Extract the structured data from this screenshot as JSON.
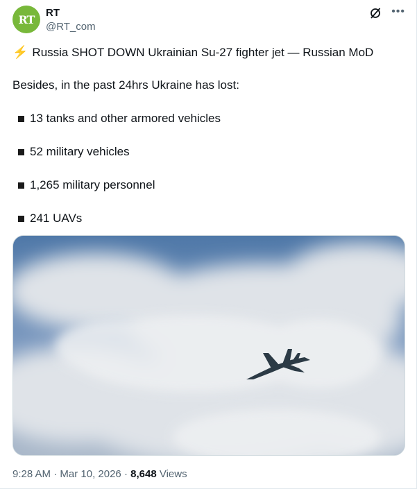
{
  "author": {
    "name": "RT",
    "handle": "@RT_com",
    "avatar_text": "RT",
    "avatar_color": "#78b83a"
  },
  "tweet": {
    "headline_icon": "lightning-icon",
    "headline": "Russia SHOT DOWN Ukrainian Su-27 fighter jet — Russian MoD",
    "intro": "Besides, in the past 24hrs Ukraine has lost:",
    "bullets": [
      "13 tanks and other armored vehicles",
      "52 military vehicles",
      "1,265 military personnel",
      "241 UAVs"
    ]
  },
  "meta": {
    "time": "9:28 AM",
    "date": "Mar 10, 2026",
    "separator": "·",
    "views_count": "8,648",
    "views_label": "Views"
  },
  "colors": {
    "text": "#0f1419",
    "secondary": "#536471",
    "sky": "#6f92bd"
  },
  "icons": {
    "grok": "grok-icon",
    "more": "more-options-icon"
  }
}
